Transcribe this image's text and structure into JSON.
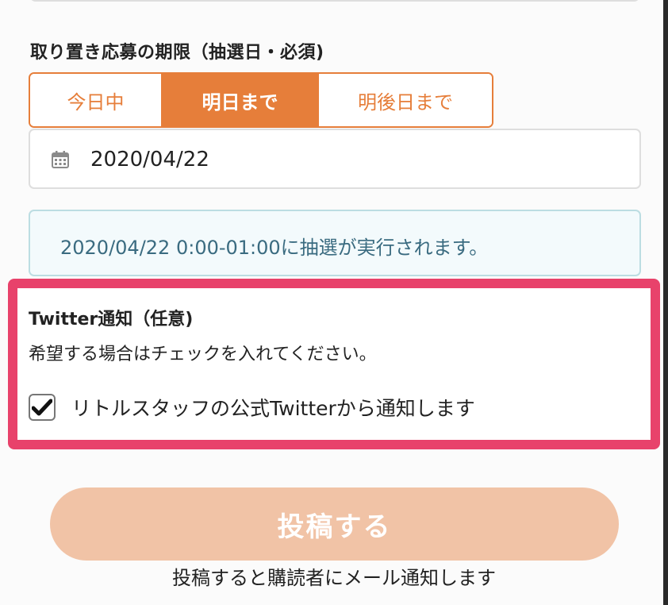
{
  "deadline": {
    "title": "取り置き応募の期限（抽選日・必須)",
    "options": [
      {
        "label": "今日中",
        "selected": false
      },
      {
        "label": "明日まで",
        "selected": true
      },
      {
        "label": "明後日まで",
        "selected": false
      }
    ],
    "date_value": "2020/04/22",
    "date_icon": "calendar-icon",
    "info_text": "2020/04/22 0:00-01:00に抽選が実行されます。"
  },
  "twitter": {
    "title": "Twitter通知（任意)",
    "help_text": "希望する場合はチェックを入れてください。",
    "option_label": "リトルスタッフの公式Twitterから通知します",
    "checked": true
  },
  "submit": {
    "label": "投稿する",
    "note": "投稿すると購読者にメール通知します"
  },
  "colors": {
    "accent": "#e67e3a",
    "highlight": "#e8426b",
    "submit_disabled": "#f1c3a6",
    "info_text": "#3a6b80"
  }
}
